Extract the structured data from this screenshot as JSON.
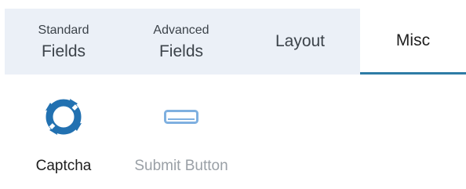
{
  "tabs": [
    {
      "small": "Standard",
      "big": "Fields",
      "active": false
    },
    {
      "small": "Advanced",
      "big": "Fields",
      "active": false
    },
    {
      "small": "",
      "big": "Layout",
      "active": false
    },
    {
      "small": "",
      "big": "Misc",
      "active": true
    }
  ],
  "fields": [
    {
      "label": "Captcha",
      "icon": "captcha-icon",
      "enabled": true
    },
    {
      "label": "Submit Button",
      "icon": "submit-button-icon",
      "enabled": false
    }
  ],
  "colors": {
    "tab_bg": "#ebf0f7",
    "active_underline": "#2e7ca6",
    "captcha_icon": "#2271b1",
    "submit_icon": "#7fb0e0",
    "disabled_text": "#9aa0a6"
  }
}
